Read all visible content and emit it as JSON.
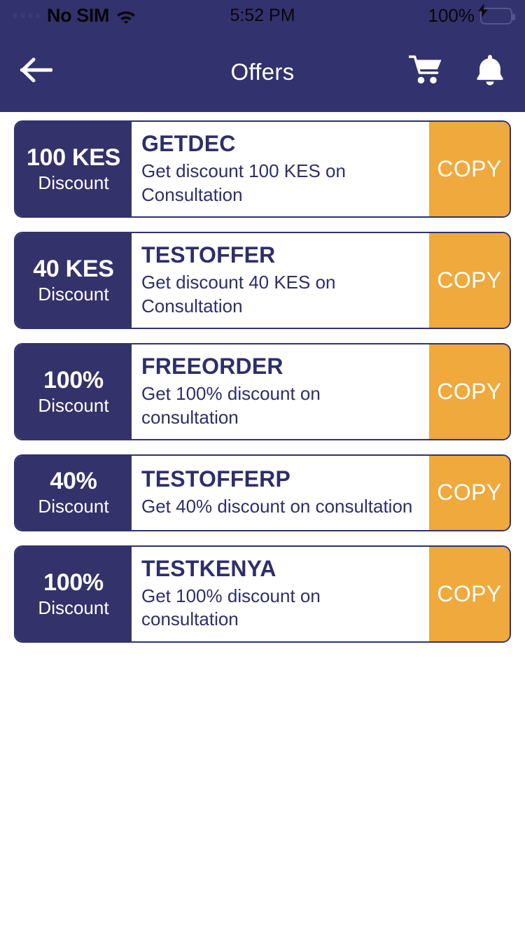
{
  "status_bar": {
    "carrier": "No SIM",
    "wifi_icon": "wifi-icon",
    "time": "5:52 PM",
    "battery_percent": "100%",
    "battery_icon": "battery-charging-icon"
  },
  "header": {
    "back_icon": "arrow-left-icon",
    "title": "Offers",
    "cart_icon": "shopping-cart-icon",
    "bell_icon": "notification-bell-icon"
  },
  "theme": {
    "navy": "#32326E",
    "card_navy": "#33326A",
    "orange": "#EFA93C",
    "white": "#FFFFFF",
    "battery_green": "#4DD865"
  },
  "offers": {
    "copy_label": "COPY",
    "discount_label": "Discount",
    "items": [
      {
        "amount": "100 KES",
        "label": "Discount",
        "code": "GETDEC",
        "description": "Get discount 100 KES on Consultation",
        "copy": "COPY"
      },
      {
        "amount": "40 KES",
        "label": "Discount",
        "code": "TESTOFFER",
        "description": "Get discount 40 KES on Consultation",
        "copy": "COPY"
      },
      {
        "amount": "100%",
        "label": "Discount",
        "code": "FREEORDER",
        "description": "Get 100% discount on consultation",
        "copy": "COPY"
      },
      {
        "amount": "40%",
        "label": "Discount",
        "code": "TESTOFFERP",
        "description": "Get 40% discount on consultation",
        "copy": "COPY"
      },
      {
        "amount": "100%",
        "label": "Discount",
        "code": "TESTKENYA",
        "description": "Get 100% discount on consultation",
        "copy": "COPY"
      }
    ]
  }
}
